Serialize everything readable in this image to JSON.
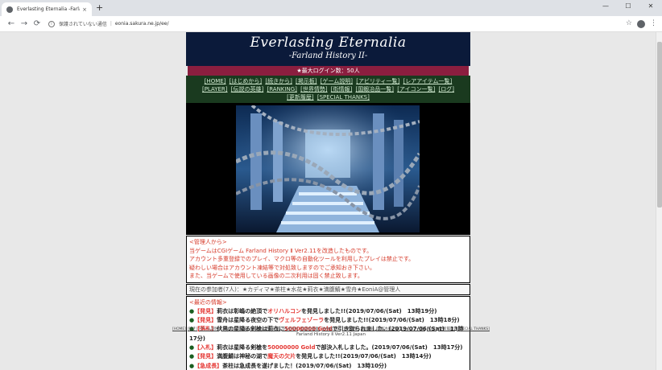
{
  "browser": {
    "tab_title": "Everlasting Eternalia -Farland Hi...",
    "tab_close": "×",
    "new_tab": "+",
    "win_min": "—",
    "win_max": "☐",
    "win_close": "✕",
    "back": "←",
    "forward": "→",
    "reload": "⟳",
    "security_text": "保護されていない通信",
    "url": "eonia.sakura.ne.jp/ee/",
    "star": "☆",
    "menu": "⋮"
  },
  "header": {
    "title": "Everlasting Eternalia",
    "subtitle": "-Farland History II-",
    "max_login": "★最大ログイン数：50人"
  },
  "menu": [
    "[HOME]",
    "[はじめから]",
    "[続きから]",
    "[掲示板]",
    "[ゲーム説明]",
    "[アビリティ一覧]",
    "[レアアイテム一覧]",
    "[PLAYER]",
    "[伝説の英雄]",
    "[RANKING]",
    "[世界情勢]",
    "[街情報]",
    "[国鍛冶品一覧]",
    "[アイコン一覧]",
    "[ログ]",
    "[更新履歴]",
    "[SPECIAL THANKS]"
  ],
  "admin": {
    "heading": "<管理人から>",
    "lines": [
      "当ゲームはCGIゲーム Farland History Ⅱ Ver2.11を改造したものです。",
      "アカウント多重登録でのプレイ、マクロ等の自動化ツールを利用したプレイは禁止です。",
      "疑わしい場合はアカウント凍結等で対処致しますのでご承知おき下さい。",
      "また、当ゲームで使用している画像の二次利用は固く禁止致します。"
    ]
  },
  "members": "現在の参加者(7人)：★カディマ★茶柱★水花★莉衣★満腹鯖★雪舟★EoniA@管理人",
  "news": {
    "heading": "<最近の情報>",
    "items": [
      {
        "tag": "【発見】",
        "text": "莉衣は彰嶋の絶頂で",
        "hl": "オリハルコン",
        "rest": "を発見しました!!(2019/07/06/(Sat)　13時19分)"
      },
      {
        "tag": "【発見】",
        "text": "雪舟は星降る夜空の下で",
        "hl": "ヴェルフェゾーラ",
        "rest": "を発見しました!!(2019/07/06/(Sat)　13時18分)"
      },
      {
        "tag": "【落札】",
        "text": "伏黒の星降る剣槍は莉衣に",
        "hl": "50000000 Gold",
        "rest": "で引き取られました。(2019/07/06/(Sat)　13時17分)"
      },
      {
        "tag": "【入札】",
        "text": "莉衣は星降る剣槍を",
        "hl": "50000000 Gold",
        "rest": "で部決入札しました。(2019/07/06/(Sat)　13時17分)"
      },
      {
        "tag": "【発見】",
        "text": "満腹鯖は神秘の湖で",
        "hl": "魔天の欠片",
        "rest": "を発見しました!!(2019/07/06/(Sat)　13時14分)"
      },
      {
        "tag": "【急成長】",
        "text": "茶柱は急成長を遂げました！(2019/07/06/(Sat)　13時10分)",
        "hl": "",
        "rest": ""
      }
    ]
  },
  "footer": {
    "links": [
      "[HOME]",
      "[続き]",
      "[ゲーム説明]",
      "[アビリティ一覧]",
      "[レアアイテム一覧]",
      "[PLAYER]",
      "[伝説の英雄]",
      "[RANKING]",
      "[世界情勢]",
      "[街情報]",
      "[国鍛冶品一覧]",
      "[アイコン一覧]",
      "[ログ]",
      "[更新履歴]",
      "[SPECIAL THANKS]"
    ],
    "credit": "Farland History Ⅱ Ver2.11 Japan"
  },
  "colors": {
    "header_bg": "#0b1a3a",
    "maxlogin_bg": "#8b1e3f",
    "menu_bg": "#1a3a1f",
    "admin_text": "#d63a2a",
    "highlight_red": "#e53935"
  }
}
